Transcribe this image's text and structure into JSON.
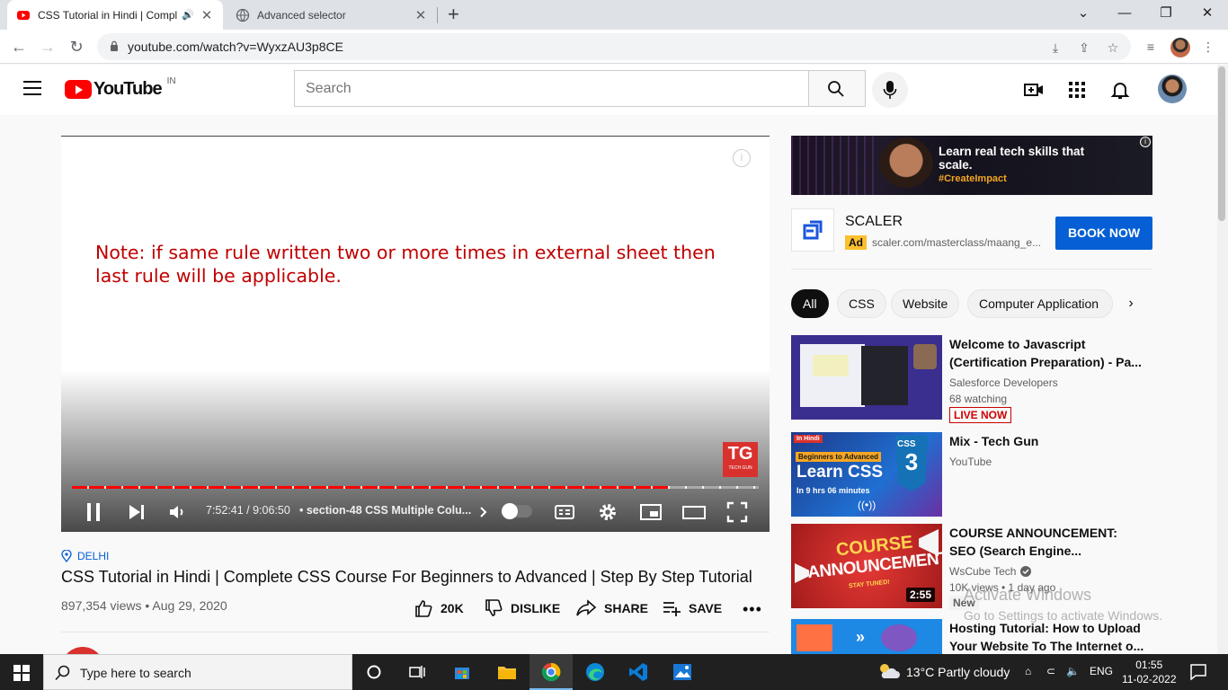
{
  "browser": {
    "tabs": [
      {
        "title": "CSS Tutorial in Hindi | Compl",
        "active": true
      },
      {
        "title": "Advanced selector",
        "active": false
      }
    ],
    "url": "youtube.com/watch?v=WyxzAU3p8CE"
  },
  "header": {
    "logo_text": "YouTube",
    "country_code": "IN",
    "search_placeholder": "Search"
  },
  "player": {
    "note_text": "Note: if same rule written two or more times in external sheet then last rule will be applicable.",
    "channel_badge": "TG",
    "channel_badge_sub": "TECH GUN",
    "time_display": "7:52:41 / 9:06:50",
    "chapter": "• section-48 CSS Multiple Colu...",
    "progress_fraction": 0.868
  },
  "video": {
    "location": "DELHI",
    "title": "CSS Tutorial in Hindi | Complete CSS Course For Beginners to Advanced | Step By Step Tutorial",
    "meta": "897,354 views • Aug 29, 2020",
    "actions": {
      "like": "20K",
      "dislike": "DISLIKE",
      "share": "SHARE",
      "save": "SAVE"
    }
  },
  "ad": {
    "banner_headline": "Learn real tech skills that scale.",
    "banner_tag": "#CreateImpact",
    "name": "SCALER",
    "badge": "Ad",
    "url": "scaler.com/masterclass/maang_e...",
    "cta": "BOOK NOW"
  },
  "chips": [
    "All",
    "CSS",
    "Website",
    "Computer Application"
  ],
  "recommendations": [
    {
      "title": "Welcome to Javascript (Certification Preparation) - Pa...",
      "channel": "Salesforce Developers",
      "stats": "68 watching",
      "badge": "LIVE NOW"
    },
    {
      "title": "Mix - Tech Gun",
      "channel": "YouTube"
    },
    {
      "title": "COURSE ANNOUNCEMENT: SEO (Search Engine...",
      "channel": "WsCube Tech",
      "stats": "10K views • 1 day ago",
      "badge": "New",
      "duration": "2:55",
      "thumb_text_1": "COURSE",
      "thumb_text_2": "ANNOUNCEMENT",
      "thumb_text_3": "STAY TUNED!"
    },
    {
      "title": "Hosting Tutorial: How to Upload Your Website To The Internet o..."
    }
  ],
  "rec_thumb_texts": {
    "css_tag": "In Hindi",
    "css_sub": "Beginners to Advanced",
    "css_main": "Learn CSS",
    "css_hours": "In 9 hrs 06 minutes",
    "css_badge": "CSS"
  },
  "watermark": {
    "line1": "Activate Windows",
    "line2": "Go to Settings to activate Windows."
  },
  "taskbar": {
    "search_placeholder": "Type here to search",
    "weather": "13°C  Partly cloudy",
    "language": "ENG",
    "time": "01:55",
    "date": "11-02-2022"
  },
  "colors": {
    "yt_red": "#ff0000",
    "link_blue": "#065fd4",
    "note_red": "#c00000",
    "ad_yellow": "#fbc02d"
  }
}
